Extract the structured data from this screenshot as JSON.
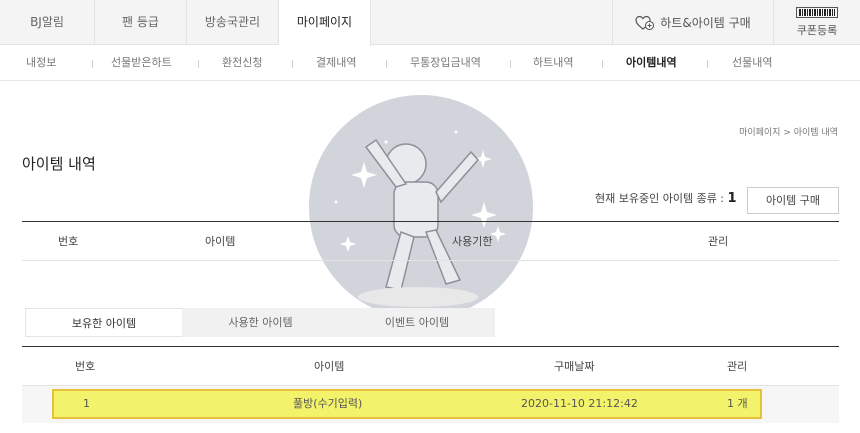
{
  "top_tabs": [
    "BJ알림",
    "팬 등급",
    "방송국관리",
    "마이페이지"
  ],
  "heart_item_buy_label": "하트&아이템 구매",
  "coupon_label": "쿠폰등록",
  "sub_nav": [
    "내정보",
    "선물받은하트",
    "환전신청",
    "결제내역",
    "무통장입금내역",
    "하트내역",
    "아이템내역",
    "선물내역"
  ],
  "breadcrumb": "마이페이지 > 아이템 내역",
  "page_title": "아이템 내역",
  "owned_count_label": "현재 보유중인 아이템 종류 :",
  "owned_count_value": "1",
  "buy_item_button": "아이템 구매",
  "table1": {
    "headers": [
      "번호",
      "아이템",
      "사용기한",
      "관리"
    ]
  },
  "item_tabs": [
    "보유한 아이템",
    "사용한 아이템",
    "이벤트 아이템"
  ],
  "table2": {
    "headers": [
      "번호",
      "아이템",
      "구매날짜",
      "관리"
    ],
    "rows": [
      {
        "no": "1",
        "item": "풀방(수기입력)",
        "date": "2020-11-10 21:12:42",
        "manage": "1 개"
      }
    ]
  }
}
